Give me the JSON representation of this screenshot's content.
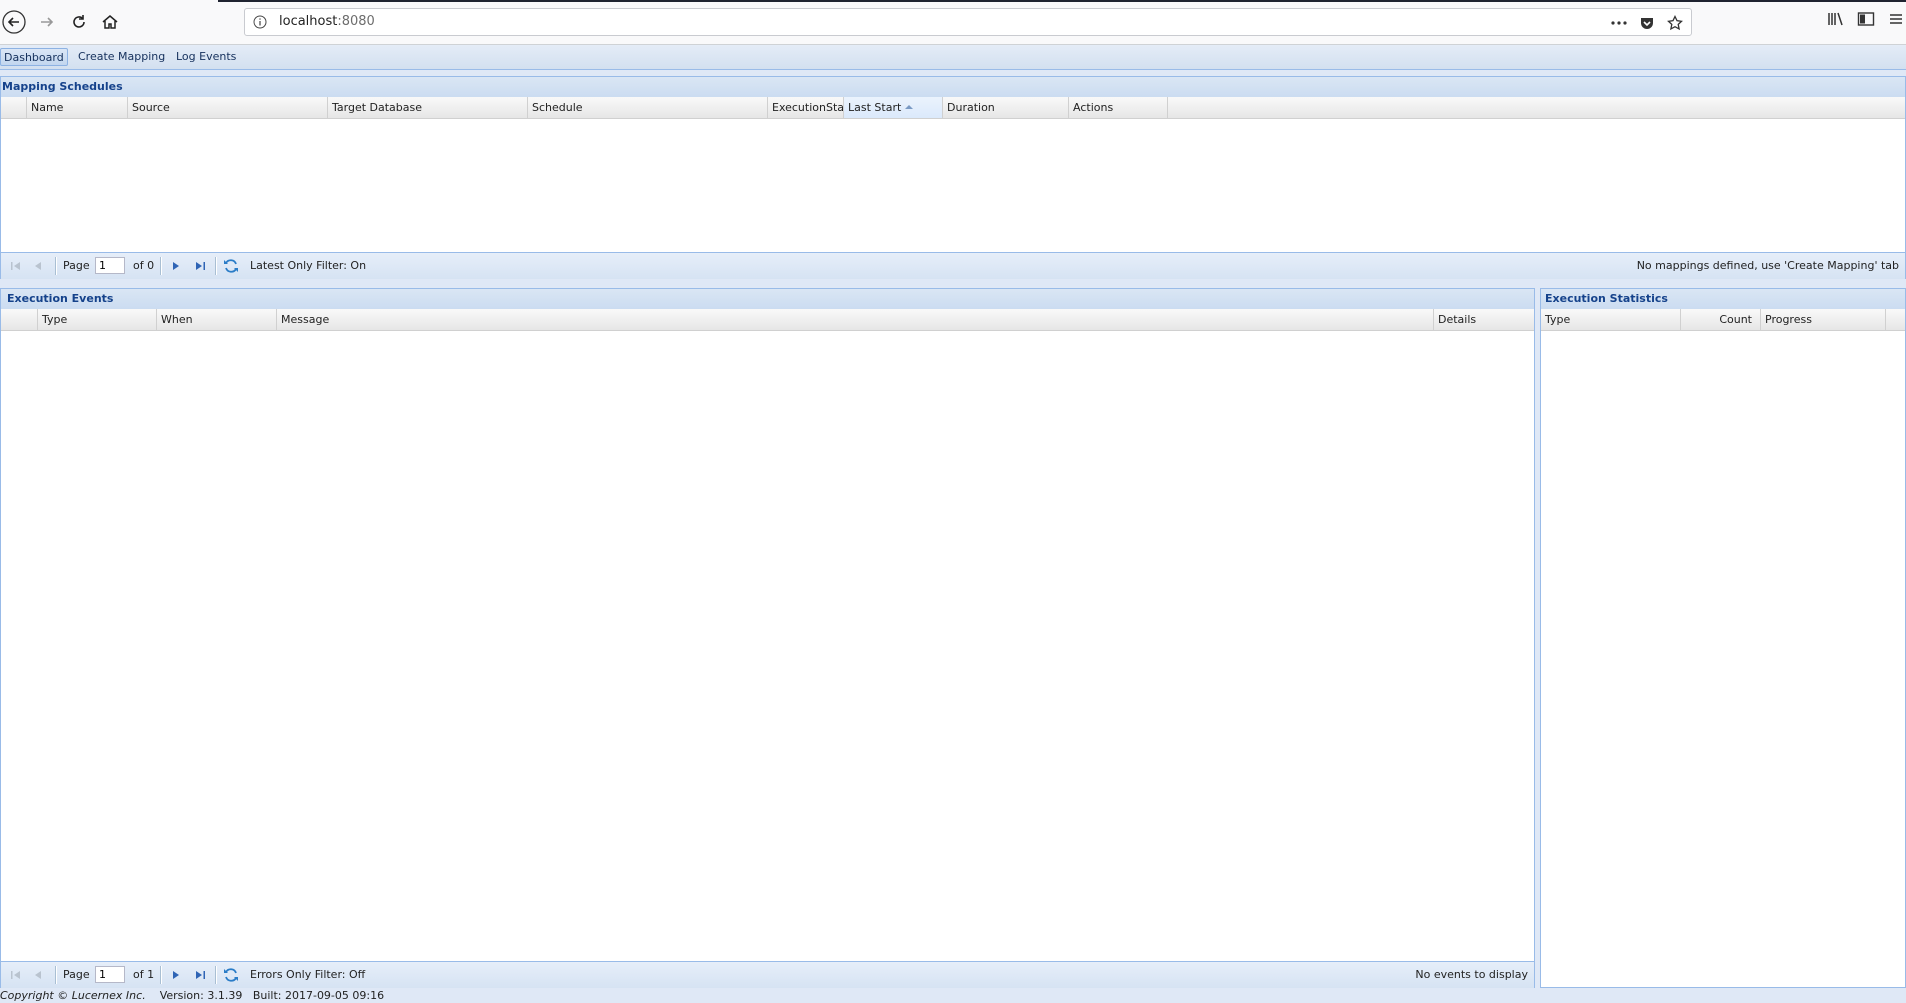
{
  "browser": {
    "url_host": "localhost",
    "url_port": ":8080"
  },
  "tabs": [
    "Dashboard",
    "Create Mapping",
    "Log Events"
  ],
  "mapping_schedules": {
    "title": "Mapping Schedules",
    "columns": [
      "",
      "Name",
      "Source",
      "Target Database",
      "Schedule",
      "ExecutionStati",
      "Last Start",
      "Duration",
      "Actions"
    ],
    "sorted_column": "Last Start",
    "page_label": "Page",
    "page_value": "1",
    "page_of": "of 0",
    "filter_label": "Latest Only Filter: On",
    "status": "No mappings defined, use 'Create Mapping' tab"
  },
  "execution_events": {
    "title": "Execution Events",
    "columns": [
      "",
      "Type",
      "When",
      "Message",
      "Details"
    ],
    "page_label": "Page",
    "page_value": "1",
    "page_of": "of 1",
    "filter_label": "Errors Only Filter: Off",
    "status": "No events to display"
  },
  "execution_statistics": {
    "title": "Execution Statistics",
    "columns": [
      "Type",
      "Count",
      "Progress"
    ]
  },
  "footer": {
    "copyright": "Copyright © Lucernex Inc.",
    "version": "Version: 3.1.39",
    "built": "Built: 2017-09-05 09:16"
  },
  "colors": {
    "panel_border": "#99bbe8",
    "panel_title": "#15428b",
    "app_background": "#dfe8f6"
  }
}
